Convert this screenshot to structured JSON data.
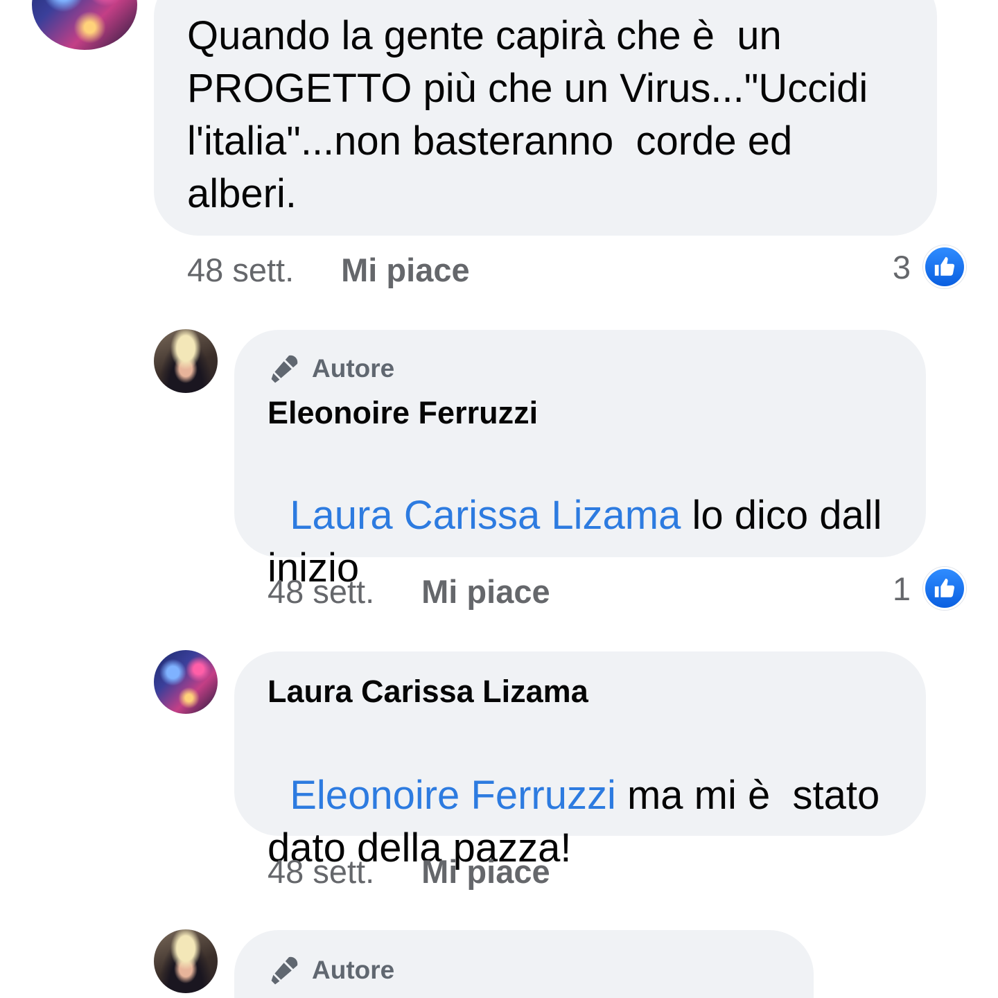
{
  "colors": {
    "bubble_bg": "#f0f2f5",
    "mention": "#2d7be0",
    "meta_text": "#65676b",
    "like_blue": "#1877f2"
  },
  "comments": [
    {
      "avatar": "city-night-avatar",
      "text": "Quando la gente capirà che è  un\nPROGETTO più che un Virus...\"Uccidi\nl'italia\"...non basteranno  corde ed\nalberi.",
      "time": "48 sett.",
      "like_label": "Mi piace",
      "reaction_count": "3"
    },
    {
      "avatar": "woman-avatar",
      "badge": "Autore",
      "author": "Eleonoire Ferruzzi",
      "mention": "Laura Carissa Lizama",
      "text_line1": " lo dico dall",
      "text_line2": "inizio",
      "time": "48 sett.",
      "like_label": "Mi piace",
      "reaction_count": "1"
    },
    {
      "avatar": "city-night-avatar",
      "author": "Laura Carissa Lizama",
      "mention": "Eleonoire Ferruzzi",
      "text_line1": " ma mi è  stato",
      "text_line2": "dato della pazza!",
      "time": "48 sett.",
      "like_label": "Mi piace"
    },
    {
      "avatar": "woman-avatar",
      "badge": "Autore"
    }
  ],
  "icons": {
    "author_badge": "microphone-icon",
    "reaction": "thumbs-up-icon"
  }
}
